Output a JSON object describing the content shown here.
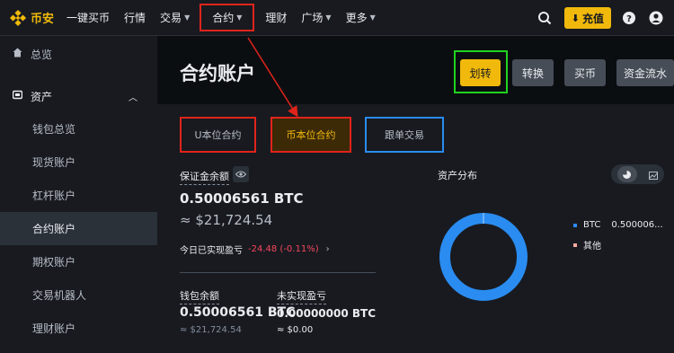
{
  "brand": {
    "name": "币安",
    "color": "#f0b90b"
  },
  "nav": {
    "items": [
      {
        "label": "一键买币",
        "caret": false
      },
      {
        "label": "行情",
        "caret": false
      },
      {
        "label": "交易",
        "caret": true
      },
      {
        "label": "合约",
        "caret": true
      },
      {
        "label": "理财",
        "caret": false
      },
      {
        "label": "广场",
        "caret": true
      },
      {
        "label": "更多",
        "caret": true
      }
    ],
    "deposit_label": "充值",
    "icons": [
      "search-icon",
      "deposit-icon",
      "help-icon",
      "user-icon"
    ]
  },
  "sidebar": {
    "overview": "总览",
    "assets": "资产",
    "items": [
      "钱包总览",
      "现货账户",
      "杠杆账户",
      "合约账户",
      "期权账户",
      "交易机器人",
      "理财账户"
    ],
    "active_index": 3
  },
  "page": {
    "title": "合约账户",
    "buttons": {
      "transfer": "划转",
      "convert": "转换",
      "buy": "买币",
      "history": "资金流水"
    }
  },
  "tabs": [
    "U本位合约",
    "币本位合约",
    "跟单交易"
  ],
  "margin": {
    "label": "保证金余额",
    "value": "0.50006561 BTC",
    "usd": "≈ $21,724.54",
    "pnl_label": "今日已实现盈亏",
    "pnl_value": "-24.48 (-0.11%)",
    "pnl_color": "#f6465d"
  },
  "wallet": {
    "label": "钱包余额",
    "value": "0.50006561 BTC",
    "usd": "≈ $21,724.54"
  },
  "unrealized": {
    "label": "未实现盈亏",
    "value": "0.00000000 BTC",
    "usd": "≈ $0.00"
  },
  "distribution": {
    "title": "资产分布",
    "legend": [
      {
        "name": "BTC",
        "value": "0.500006...",
        "color": "#2a8cf0"
      },
      {
        "name": "其他",
        "value": "",
        "color": "#f8a9a0"
      }
    ]
  },
  "chart_data": {
    "type": "pie",
    "labels": [
      "BTC",
      "其他"
    ],
    "values": [
      100,
      0
    ]
  }
}
